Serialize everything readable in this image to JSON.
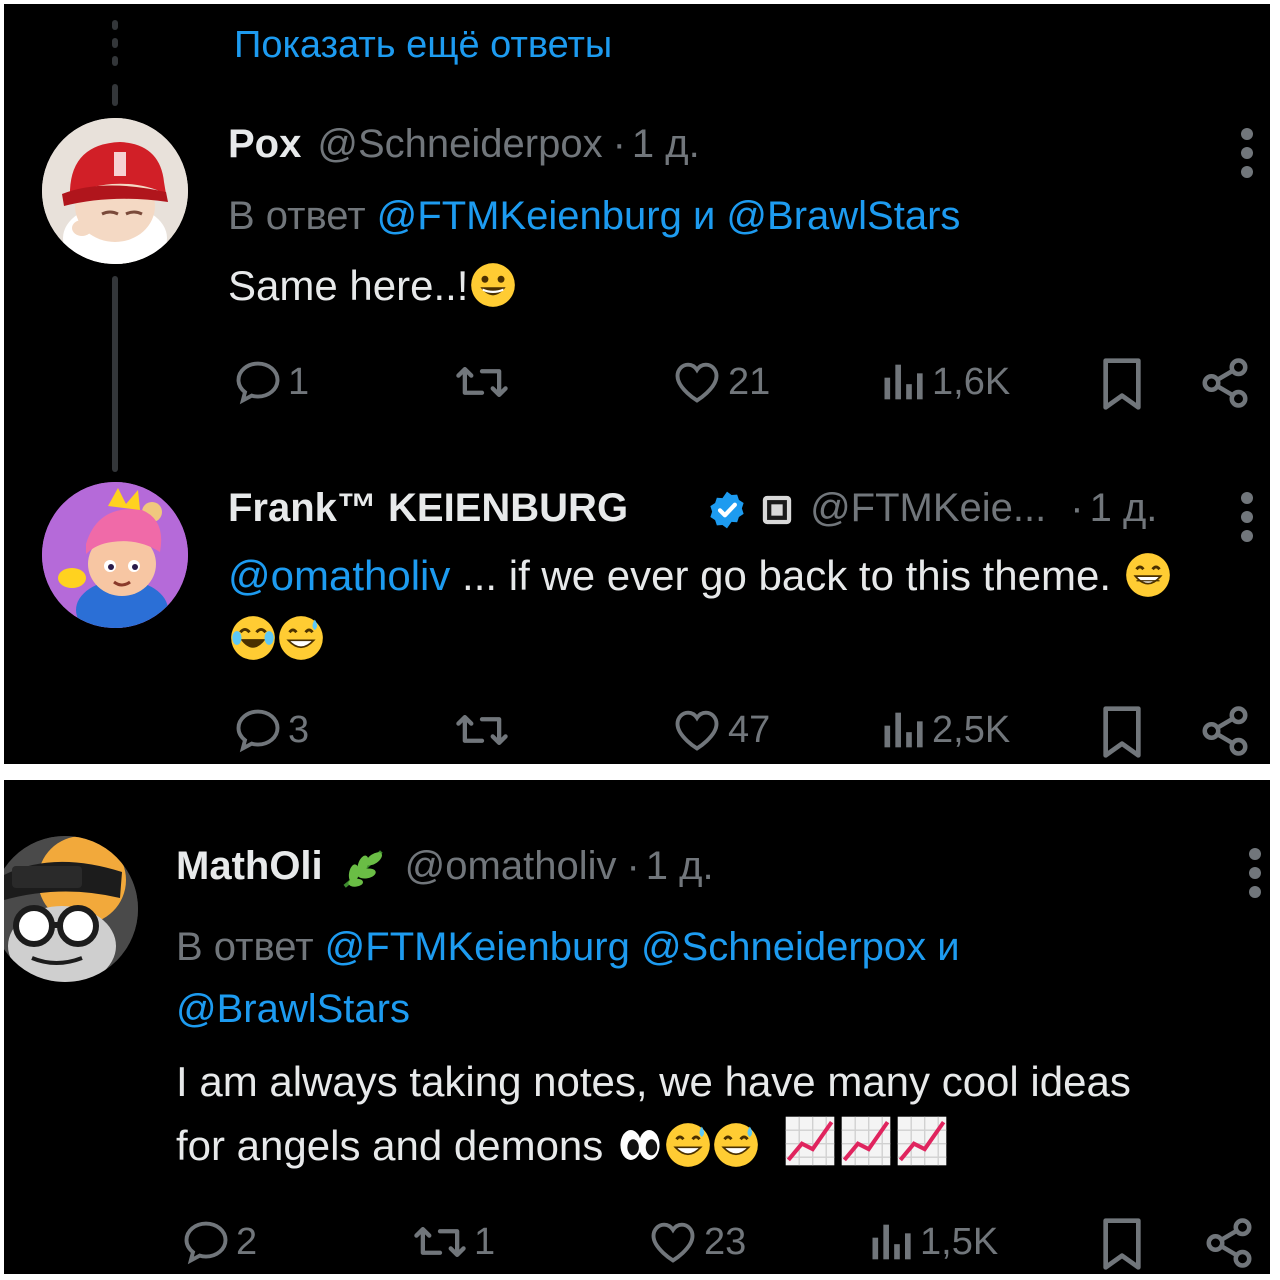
{
  "panel_top": {
    "show_more": "Показать ещё ответы",
    "tweet1": {
      "name": "Pox",
      "handle": "@Schneiderpox",
      "separator": "·",
      "time": "1 д.",
      "reply_prefix": "В ответ",
      "reply_mention_1": "@FTMKeienburg",
      "reply_conjunction": "и",
      "reply_mention_2": "@BrawlStars",
      "text": "Same here..!",
      "actions": {
        "replies": "1",
        "retweets": "",
        "likes": "21",
        "views": "1,6K"
      }
    },
    "tweet2": {
      "name": "Frank™ KEIENBURG",
      "handle": "@FTMKeie...",
      "separator": "·",
      "time": "1 д.",
      "mention": "@omatholiv",
      "text": " ... if we ever go back to this theme.",
      "actions": {
        "replies": "3",
        "retweets": "",
        "likes": "47",
        "views": "2,5K"
      }
    }
  },
  "panel_bottom": {
    "tweet3": {
      "name": "MathOli",
      "handle": "@omatholiv",
      "separator": "·",
      "time": "1 д.",
      "reply_prefix": "В ответ",
      "reply_mention_1": "@FTMKeienburg",
      "reply_mention_2": "@Schneiderpox",
      "reply_conjunction": "и",
      "reply_mention_3": "@BrawlStars",
      "text_line1": "I am always taking notes, we have many cool ideas",
      "text_line2": "for angels and demons",
      "actions": {
        "replies": "2",
        "retweets": "1",
        "likes": "23",
        "views": "1,5K"
      }
    }
  },
  "colors": {
    "background": "#000000",
    "text": "#e7e9ea",
    "muted": "#71767b",
    "link": "#1d9bf0",
    "verified": "#1d9bf0"
  },
  "icons": [
    "reply-icon",
    "retweet-icon",
    "like-icon",
    "views-icon",
    "bookmark-icon",
    "share-icon",
    "more-icon",
    "verified-badge-icon",
    "plant-icon",
    "grin-emoji",
    "laugh-emoji",
    "sweat-smile-emoji",
    "eyes-emoji",
    "chart-increasing-emoji"
  ]
}
